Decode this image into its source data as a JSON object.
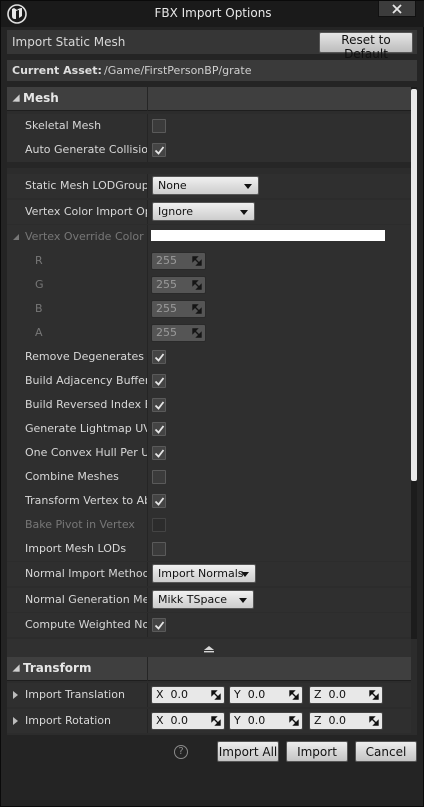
{
  "window": {
    "title": "FBX Import Options"
  },
  "header": {
    "label": "Import Static Mesh",
    "reset_label": "Reset to Default"
  },
  "asset": {
    "key": "Current Asset:",
    "path": "/Game/FirstPersonBP/grate"
  },
  "mesh": {
    "category": "Mesh",
    "skeletal_mesh": {
      "label": "Skeletal Mesh",
      "checked": false
    },
    "auto_collision": {
      "label": "Auto Generate Collision",
      "checked": true
    },
    "lod_group": {
      "label": "Static Mesh LODGroup",
      "value": "None"
    },
    "vertex_color_import": {
      "label": "Vertex Color Import Opti",
      "value": "Ignore"
    },
    "vertex_override_color": {
      "label": "Vertex Override Color",
      "color": "#ffffff"
    },
    "r": {
      "label": "R",
      "value": "255"
    },
    "g": {
      "label": "G",
      "value": "255"
    },
    "b": {
      "label": "B",
      "value": "255"
    },
    "a": {
      "label": "A",
      "value": "255"
    },
    "remove_degenerates": {
      "label": "Remove Degenerates",
      "checked": true
    },
    "build_adjacency": {
      "label": "Build Adjacency Buffer",
      "checked": true
    },
    "build_reversed_index": {
      "label": "Build Reversed Index Bu",
      "checked": true
    },
    "generate_lightmap_uvs": {
      "label": "Generate Lightmap UVs",
      "checked": true
    },
    "one_convex_hull": {
      "label": "One Convex Hull Per UC",
      "checked": true
    },
    "combine_meshes": {
      "label": "Combine Meshes",
      "checked": false
    },
    "transform_vertex": {
      "label": "Transform Vertex to Abs",
      "checked": true
    },
    "bake_pivot": {
      "label": "Bake Pivot in Vertex",
      "checked": false,
      "disabled": true
    },
    "import_mesh_lods": {
      "label": "Import Mesh LODs",
      "checked": false
    },
    "normal_import_method": {
      "label": "Normal Import Method",
      "value": "Import Normals"
    },
    "normal_generation_method": {
      "label": "Normal Generation Meth",
      "value": "Mikk TSpace"
    },
    "compute_weighted_normals": {
      "label": "Compute Weighted Norm",
      "checked": true
    }
  },
  "transform": {
    "category": "Transform",
    "translation": {
      "label": "Import Translation",
      "x_label": "X",
      "x": "0.0",
      "y_label": "Y",
      "y": "0.0",
      "z_label": "Z",
      "z": "0.0"
    },
    "rotation": {
      "label": "Import Rotation",
      "x_label": "X",
      "x": "0.0",
      "y_label": "Y",
      "y": "0.0",
      "z_label": "Z",
      "z": "0.0"
    }
  },
  "footer": {
    "help": "?",
    "import_all": "Import All",
    "import": "Import",
    "cancel": "Cancel"
  },
  "icons": {
    "logo": "unreal-logo-icon",
    "close": "close-icon",
    "collapse": "collapse-up-icon"
  }
}
